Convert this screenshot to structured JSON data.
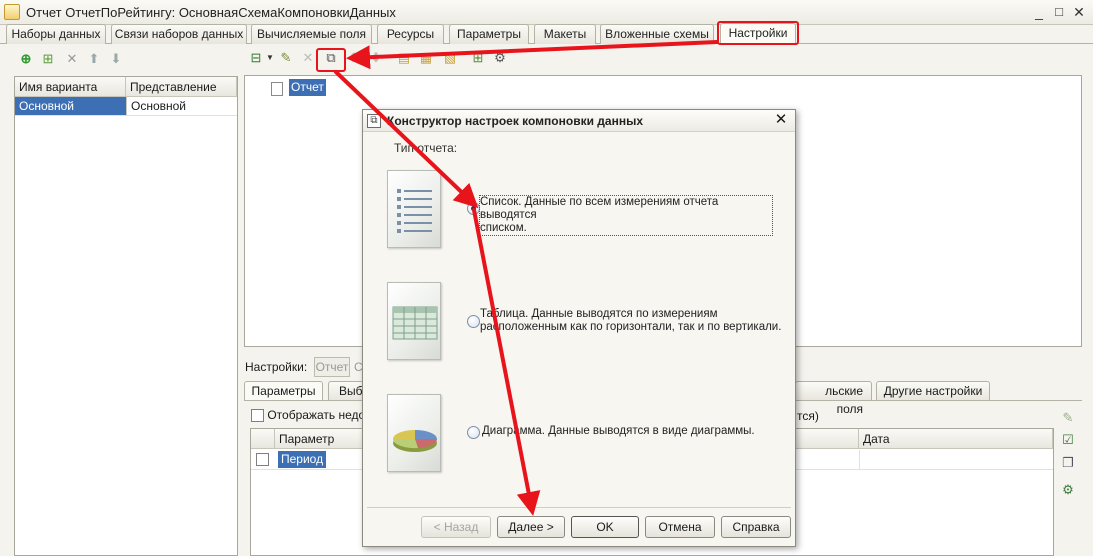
{
  "window": {
    "title": "Отчет ОтчетПоРейтингу: ОсновнаяСхемаКомпоновкиДанных",
    "minimize": "_",
    "maximize": "□",
    "close": "✕"
  },
  "tabs": [
    {
      "label": "Наборы данных"
    },
    {
      "label": "Связи наборов данных"
    },
    {
      "label": "Вычисляемые поля"
    },
    {
      "label": "Ресурсы"
    },
    {
      "label": "Параметры"
    },
    {
      "label": "Макеты"
    },
    {
      "label": "Вложенные схемы"
    },
    {
      "label": "Настройки",
      "active": true
    }
  ],
  "variants": {
    "columns": [
      "Имя варианта",
      "Представление"
    ],
    "rows": [
      [
        "Основной",
        "Основной"
      ]
    ]
  },
  "tree": {
    "root_label": "Отчет"
  },
  "settings": {
    "label": "Настройки:",
    "button": "Отчет",
    "button_fragment": "С",
    "tabs": [
      "Параметры",
      "Выбр",
      "льские поля",
      "Другие настройки"
    ],
    "show_checkbox_text": "Отображать недос",
    "show_checkbox_tail": "тся)",
    "params_columns": [
      "Параметр",
      "Дата"
    ],
    "params_rows": [
      {
        "name": "Период"
      }
    ]
  },
  "dialog": {
    "title": "Конструктор настроек компоновки данных",
    "report_type_label": "Тип отчета:",
    "options": [
      {
        "line1": "Список. Данные по всем измерениям отчета выводятся",
        "line2": "списком.",
        "checked": true,
        "icon": "list-report-icon"
      },
      {
        "line1": "Таблица. Данные выводятся по измерениям",
        "line2": "расположенным как по горизонтали, так и по вертикали.",
        "checked": false,
        "icon": "table-report-icon"
      },
      {
        "line1": "Диаграмма. Данные выводятся в виде диаграммы.",
        "line2": "",
        "checked": false,
        "icon": "chart-report-icon"
      }
    ],
    "buttons": {
      "back": "< Назад",
      "next": "Далее >",
      "ok": "OK",
      "cancel": "Отмена",
      "help": "Справка"
    }
  },
  "colors": {
    "annotation_red": "#e8141c",
    "selection_blue": "#3d6fb5"
  }
}
